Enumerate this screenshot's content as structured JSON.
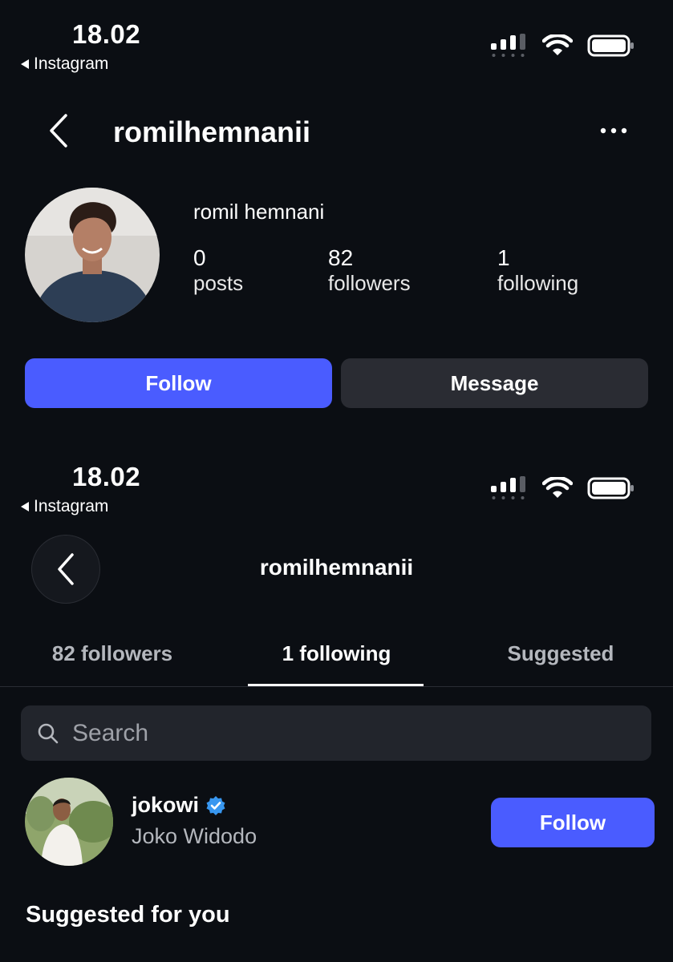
{
  "screen1": {
    "status": {
      "time": "18.02",
      "back_app": "Instagram"
    },
    "header": {
      "username": "romilhemnanii"
    },
    "profile": {
      "display_name": "romil hemnani",
      "stats": [
        {
          "value": "0",
          "label": "posts"
        },
        {
          "value": "82",
          "label": "followers"
        },
        {
          "value": "1",
          "label": "following"
        }
      ]
    },
    "actions": {
      "follow": "Follow",
      "message": "Message"
    }
  },
  "screen2": {
    "status": {
      "time": "18.02",
      "back_app": "Instagram"
    },
    "header": {
      "username": "romilhemnanii"
    },
    "tabs": [
      "82 followers",
      "1 following",
      "Suggested"
    ],
    "search": {
      "placeholder": "Search"
    },
    "list": [
      {
        "username": "jokowi",
        "verified": true,
        "name": "Joko Widodo",
        "button": "Follow"
      }
    ],
    "section_title": "Suggested for you"
  },
  "colors": {
    "background": "#0b0e13",
    "accent": "#4a5cff",
    "secondary_button": "#2a2c33",
    "verified": "#3897f0"
  },
  "icons": [
    "back-chevron-icon",
    "more-horizontal-icon",
    "signal-icon",
    "wifi-icon",
    "battery-icon",
    "search-icon",
    "verified-badge-icon"
  ]
}
